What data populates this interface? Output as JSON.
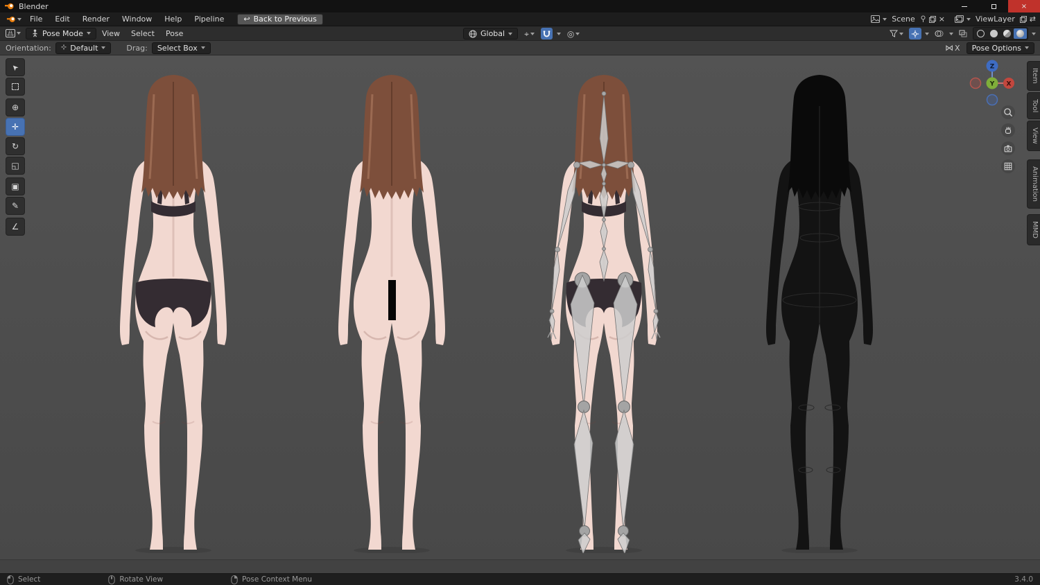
{
  "colors": {
    "accent": "#4772b3",
    "axis_x": "#c3473e",
    "axis_y": "#7fae3a",
    "axis_z": "#3e6cc3",
    "viewport_bg": "#4d4d4d"
  },
  "titlebar": {
    "title": "Blender"
  },
  "menubar": {
    "items": [
      "File",
      "Edit",
      "Render",
      "Window",
      "Help",
      "Pipeline"
    ],
    "back_button": "Back to Previous",
    "scene": "Scene",
    "view_layer": "ViewLayer"
  },
  "header": {
    "mode": "Pose Mode",
    "menus": [
      "View",
      "Select",
      "Pose"
    ],
    "orientation": "Global"
  },
  "tool_settings": {
    "orientation_label": "Orientation:",
    "orientation_value": "Default",
    "drag_label": "Drag:",
    "drag_value": "Select Box",
    "mirror_x": "X",
    "pose_options": "Pose Options"
  },
  "toolbar": {
    "tools": [
      "tweak",
      "select-box",
      "cursor",
      "move",
      "rotate",
      "scale",
      "transform",
      "annotate",
      "measure"
    ],
    "active_tool": "move"
  },
  "viewport": {
    "models": [
      "female-back-textured",
      "female-back-censored",
      "female-back-armature",
      "female-back-wireframe"
    ]
  },
  "gizmo": {
    "x": "X",
    "y": "Y",
    "z": "Z"
  },
  "sidebar": {
    "tabs": [
      "Item",
      "Tool",
      "View",
      "Animation",
      "MMD"
    ]
  },
  "statusbar": {
    "hints": [
      {
        "label": "Select"
      },
      {
        "label": "Rotate View"
      },
      {
        "label": "Pose Context Menu"
      }
    ],
    "version": "3.4.0"
  },
  "icons": {
    "tweak": "➤",
    "cursor": "⊕",
    "move": "✛",
    "rotate": "↻",
    "scale": "◱",
    "transform": "▣",
    "annotate": "✎",
    "measure": "∠",
    "pivot": "⌖",
    "proportional": "◎",
    "mirror": "⋈",
    "back": "↩",
    "swap": "⇄",
    "unlink": "×",
    "close": "×"
  }
}
